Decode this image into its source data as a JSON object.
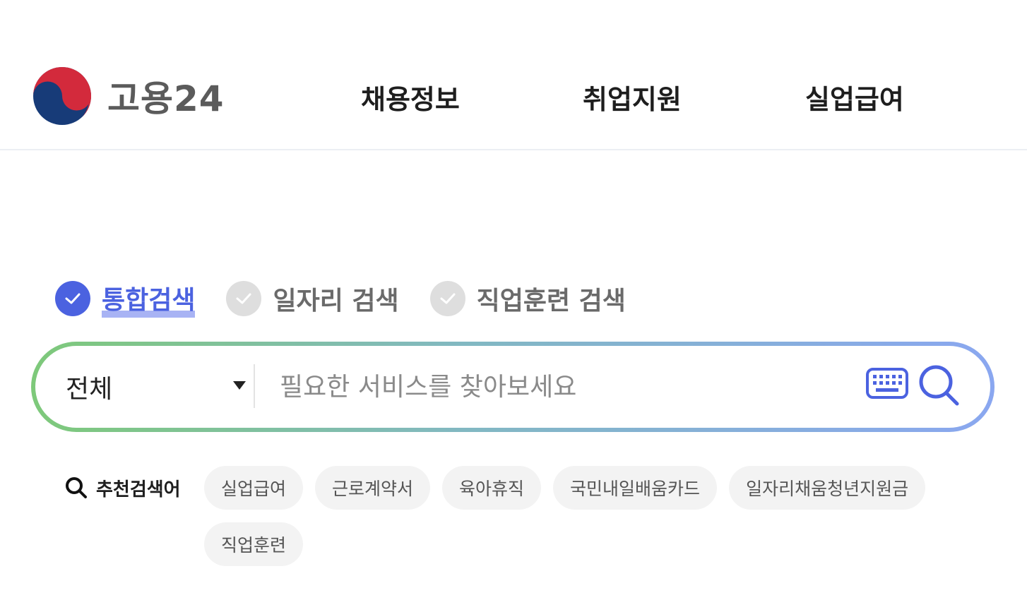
{
  "logo": {
    "text": "고용24",
    "icon": "taegeuk-icon"
  },
  "nav": {
    "items": [
      {
        "label": "채용정보"
      },
      {
        "label": "취업지원"
      },
      {
        "label": "실업급여"
      }
    ]
  },
  "search_tabs": [
    {
      "label": "통합검색",
      "selected": true,
      "icon": "check-icon"
    },
    {
      "label": "일자리 검색",
      "selected": false,
      "icon": "check-icon"
    },
    {
      "label": "직업훈련 검색",
      "selected": false,
      "icon": "check-icon"
    }
  ],
  "search": {
    "scope": "전체",
    "placeholder": "필요한 서비스를 찾아보세요",
    "keyboard_icon": "keyboard-icon",
    "search_icon": "search-icon"
  },
  "recommend": {
    "label": "추천검색어",
    "keywords": [
      "실업급여",
      "근로계약서",
      "육아휴직",
      "국민내일배움카드",
      "일자리채움청년지원금",
      "직업훈련"
    ]
  },
  "colors": {
    "accent": "#4b62e0",
    "gradient_start": "#7ec97a",
    "gradient_end": "#8aa7f0"
  }
}
